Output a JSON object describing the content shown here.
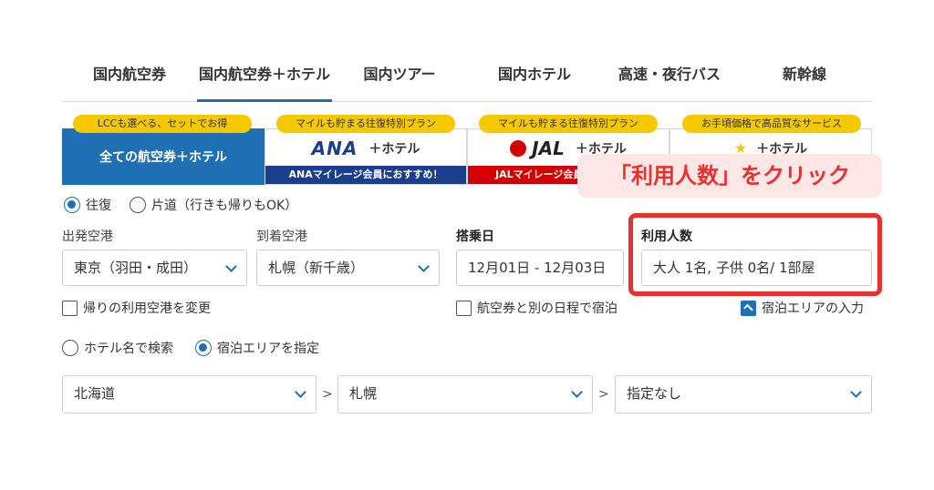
{
  "tabs": [
    "国内航空券",
    "国内航空券＋ホテル",
    "国内ツアー",
    "国内ホテル",
    "高速・夜行バス",
    "新幹線"
  ],
  "plans": [
    {
      "badge": "LCCも選べる、セットでお得",
      "main": "全ての航空券＋ホテル"
    },
    {
      "badge": "マイルも貯まる往復特別プラン",
      "logo": "ANA",
      "main": "＋ホテル",
      "sub": "ANAマイレージ会員におすすめ！"
    },
    {
      "badge": "マイルも貯まる往復特別プラン",
      "logo": "JAL",
      "main": "＋ホテル",
      "sub": "JALマイレージ会員"
    },
    {
      "badge": "お手頃価格で高品質なサービス",
      "main": "＋ホテル"
    }
  ],
  "callout": "「利用人数」をクリック",
  "trip_type": {
    "round": "往復",
    "oneway": "片道（行きも帰りもOK）"
  },
  "fields": {
    "departure_label": "出発空港",
    "departure_value": "東京（羽田・成田）",
    "arrival_label": "到着空港",
    "arrival_value": "札幌（新千歳）",
    "date_label": "搭乗日",
    "date_value": "12月01日 - 12月03日",
    "pax_label": "利用人数",
    "pax_value": "大人 1名, 子供 0名/ 1部屋"
  },
  "checks": {
    "return_airport": "帰りの利用空港を変更",
    "separate_dates": "航空券と別の日程で宿泊",
    "stay_area": "宿泊エリアの入力"
  },
  "hotel_search": {
    "by_name": "ホテル名で検索",
    "by_area": "宿泊エリアを指定"
  },
  "area": {
    "region": "北海道",
    "city": "札幌",
    "district": "指定なし",
    "separator": ">"
  },
  "colors": {
    "brand": "#1f6fb5",
    "badge": "#f5c800",
    "ana_navy": "#1a3e8c",
    "jal_red": "#d40000",
    "highlight": "#e8312f"
  }
}
